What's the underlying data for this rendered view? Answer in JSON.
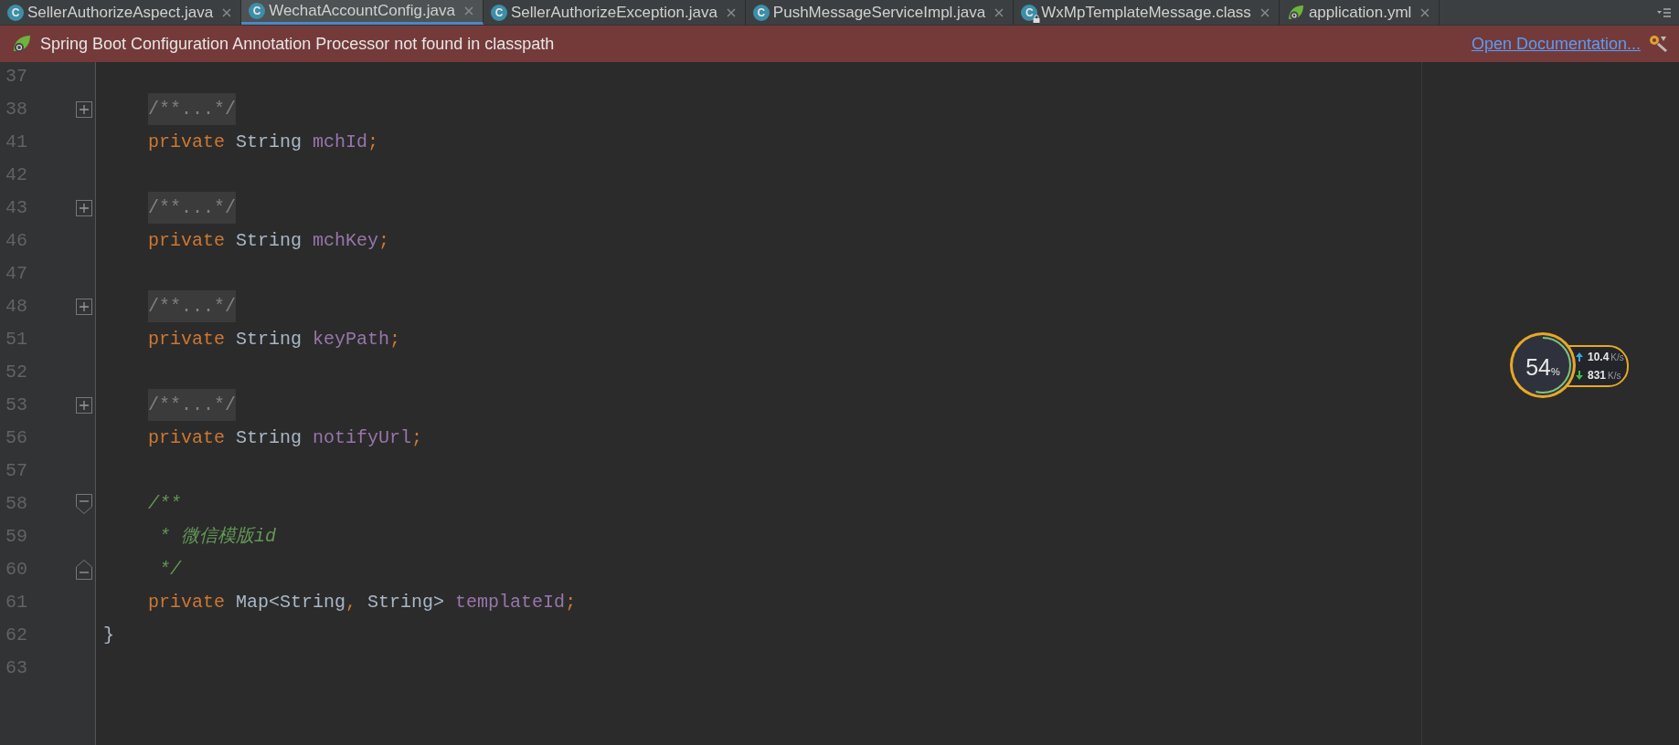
{
  "tabs": [
    {
      "label": "SellerAuthorizeAspect.java",
      "kind": "class",
      "icon_text": "C",
      "selected": false
    },
    {
      "label": "WechatAccountConfig.java",
      "kind": "class",
      "icon_text": "C",
      "selected": true
    },
    {
      "label": "SellerAuthorizeException.java",
      "kind": "class",
      "icon_text": "C",
      "selected": false
    },
    {
      "label": "PushMessageServiceImpl.java",
      "kind": "class",
      "icon_text": "C",
      "selected": false
    },
    {
      "label": "WxMpTemplateMessage.class",
      "kind": "locked-class",
      "icon_text": "C",
      "selected": false
    },
    {
      "label": "application.yml",
      "kind": "spring",
      "selected": false
    }
  ],
  "banner": {
    "message": "Spring Boot Configuration Annotation Processor not found in classpath",
    "link": "Open Documentation..."
  },
  "editor": {
    "lines": [
      {
        "number": "37",
        "kind": "blank"
      },
      {
        "number": "38",
        "kind": "folded",
        "tokens": [
          {
            "kind": "folded",
            "text": "/**...*/"
          }
        ]
      },
      {
        "number": "41",
        "kind": "member",
        "tokens": [
          {
            "kind": "keyword",
            "text": "private"
          },
          {
            "kind": "type",
            "text": " String "
          },
          {
            "kind": "field",
            "text": "mchId"
          },
          {
            "kind": "punct",
            "text": ";"
          }
        ]
      },
      {
        "number": "42",
        "kind": "blank"
      },
      {
        "number": "43",
        "kind": "folded",
        "tokens": [
          {
            "kind": "folded",
            "text": "/**...*/"
          }
        ]
      },
      {
        "number": "46",
        "kind": "member",
        "tokens": [
          {
            "kind": "keyword",
            "text": "private"
          },
          {
            "kind": "type",
            "text": " String "
          },
          {
            "kind": "field",
            "text": "mchKey"
          },
          {
            "kind": "punct",
            "text": ";"
          }
        ]
      },
      {
        "number": "47",
        "kind": "blank"
      },
      {
        "number": "48",
        "kind": "folded",
        "tokens": [
          {
            "kind": "folded",
            "text": "/**...*/"
          }
        ]
      },
      {
        "number": "51",
        "kind": "member",
        "tokens": [
          {
            "kind": "keyword",
            "text": "private"
          },
          {
            "kind": "type",
            "text": " String "
          },
          {
            "kind": "field",
            "text": "keyPath"
          },
          {
            "kind": "punct",
            "text": ";"
          }
        ]
      },
      {
        "number": "52",
        "kind": "blank"
      },
      {
        "number": "53",
        "kind": "folded",
        "tokens": [
          {
            "kind": "folded",
            "text": "/**...*/"
          }
        ]
      },
      {
        "number": "56",
        "kind": "member",
        "tokens": [
          {
            "kind": "keyword",
            "text": "private"
          },
          {
            "kind": "type",
            "text": " String "
          },
          {
            "kind": "field",
            "text": "notifyUrl"
          },
          {
            "kind": "punct",
            "text": ";"
          }
        ]
      },
      {
        "number": "57",
        "kind": "blank"
      },
      {
        "number": "58",
        "kind": "doc-open",
        "tokens": [
          {
            "kind": "doc",
            "text": "/**"
          }
        ]
      },
      {
        "number": "59",
        "kind": "doc-body",
        "tokens": [
          {
            "kind": "doc",
            "text": "* 微信模版id"
          }
        ]
      },
      {
        "number": "60",
        "kind": "doc-close",
        "tokens": [
          {
            "kind": "doc",
            "text": "*/"
          }
        ]
      },
      {
        "number": "61",
        "kind": "member",
        "tokens": [
          {
            "kind": "keyword",
            "text": "private"
          },
          {
            "kind": "type",
            "text": " Map<String"
          },
          {
            "kind": "punct",
            "text": ","
          },
          {
            "kind": "type",
            "text": " String> "
          },
          {
            "kind": "field",
            "text": "templateId"
          },
          {
            "kind": "punct",
            "text": ";"
          }
        ]
      },
      {
        "number": "62",
        "kind": "top",
        "tokens": [
          {
            "kind": "type",
            "text": "}"
          }
        ]
      },
      {
        "number": "63",
        "kind": "blank"
      }
    ]
  },
  "monitor": {
    "percent": "54",
    "percent_sign": "%",
    "upload": "10.4",
    "upload_unit": "K/s",
    "download": "831",
    "download_unit": "K/s"
  }
}
